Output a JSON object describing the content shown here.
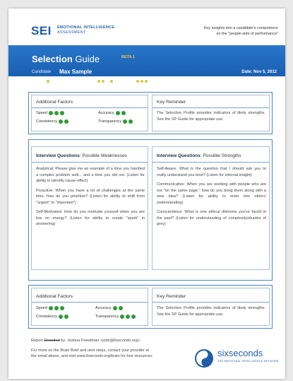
{
  "logo": {
    "mark": "SEI",
    "line1": "EMOTIONAL INTELLIGENCE",
    "line2": "ASSESSMENT"
  },
  "tagline": {
    "line1": "Key insights into a candidate's competence",
    "line2": "on the \"people-side of performance\""
  },
  "header": {
    "title_bold": "Selection",
    "title_rest": " Guide",
    "beta": "BETA 1",
    "candidate_label": "Candidate",
    "candidate_name": "Max Sample",
    "date": "Date: Nov 5, 2012"
  },
  "factors_top": {
    "title": "Additional Factors",
    "items": [
      {
        "label": "Speed",
        "dots": 3
      },
      {
        "label": "Accuracy",
        "dots": 2
      },
      {
        "label": "Consistency",
        "dots": 2
      },
      {
        "label": "Transparency",
        "dots": 2
      }
    ]
  },
  "reminder_top": {
    "title": "Key Reminder",
    "text": "The Selection Profile provides indicators of likely strengths. See the SP Guide for appropriate use."
  },
  "weaknesses": {
    "title_bold": "Interview Questions",
    "title_rest": ": Possible Weaknesses",
    "items": [
      "Analytical: Please give me an example of a time you handled a complex problem well... and a time you did not. (Listen for ability to identify cause-effect)",
      "Proactive: When you have a lot of challenges at the same time, how do you prioritize? (Listen for ability to shift from \"urgent\" to \"important\")",
      "Self-Motivated: How do you motivate yourself when you are low on energy? (Listen for ability to create \"spark\" in answering)"
    ]
  },
  "strengths": {
    "title_bold": "Interview Questions",
    "title_rest": ": Possible Strengths",
    "items": [
      "Self-Aware: What is the question that I should ask you to really understand you best? (Listen for internal insight)",
      "Communicative: When you are working with people who are not \"on the same page,\" how do you bring them along with a new idea? (Listen for ability to enter into others' understanding)",
      "Conscientious: What is one ethical dilemma you've faced in the past? (Listen for understanding of complexity/shades of grey)"
    ]
  },
  "factors_bottom": {
    "title": "Additional Factors",
    "items": [
      {
        "label": "Speed",
        "dots": 3
      },
      {
        "label": "Accuracy",
        "dots": 2
      },
      {
        "label": "Consistency",
        "dots": 2
      },
      {
        "label": "Transparency",
        "dots": 3
      }
    ]
  },
  "reminder_bottom": {
    "title": "Key Reminder",
    "text": "The Selection Profile provides indicators of likely strengths. See the SP Guide for appropriate use."
  },
  "footer": {
    "report_prefix": "Report ",
    "report_struck": "Decoded",
    "report_rest": " by: Joshua Freedman <josh@6seconds.org>",
    "line2": "For more on the Brain Brief and next steps, contact your provider at",
    "line3": "the email above, and visit www.6seconds.org/brain for free resources."
  },
  "sixseconds": {
    "name": "sixseconds",
    "sub": "THE EMOTIONAL INTELLIGENCE NETWORK"
  },
  "colors": {
    "accent": "#1f5da8",
    "dot_green": "#2f9a35",
    "dot_yellow": "#d6c84a"
  }
}
